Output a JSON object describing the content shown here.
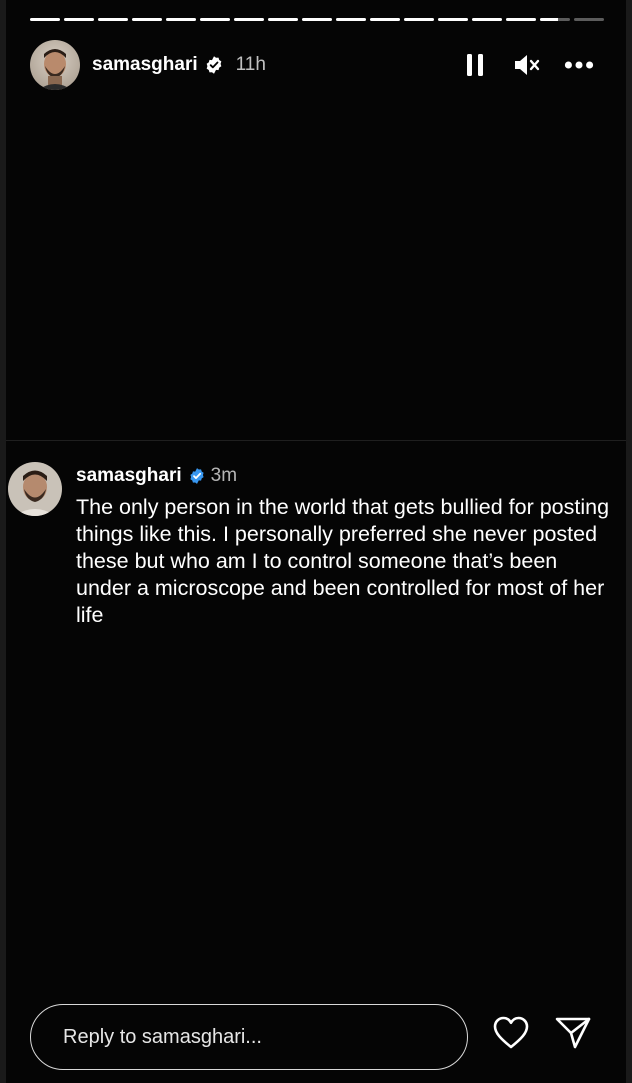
{
  "story": {
    "progress": {
      "segment_count": 17,
      "completed_segments": 15,
      "current_segment_fraction": 0.6
    }
  },
  "header": {
    "username": "samasghari",
    "time": "11h",
    "verified": true,
    "icons": {
      "pause": "pause-icon",
      "mute": "muted-speaker-icon",
      "more": "more-options-icon"
    }
  },
  "post": {
    "username": "samasghari",
    "verified": true,
    "time": "3m",
    "text": "The only person in the world that gets bullied for posting things like this. I personally preferred she never posted  these but who am I to control someone that’s been under a microscope and been controlled for most of her life"
  },
  "footer": {
    "reply_placeholder": "Reply to samasghari...",
    "icons": {
      "like": "heart-icon",
      "share": "send-icon"
    }
  },
  "colors": {
    "background": "#000000",
    "verified_badge": "#3897f0",
    "text": "#ffffff"
  }
}
